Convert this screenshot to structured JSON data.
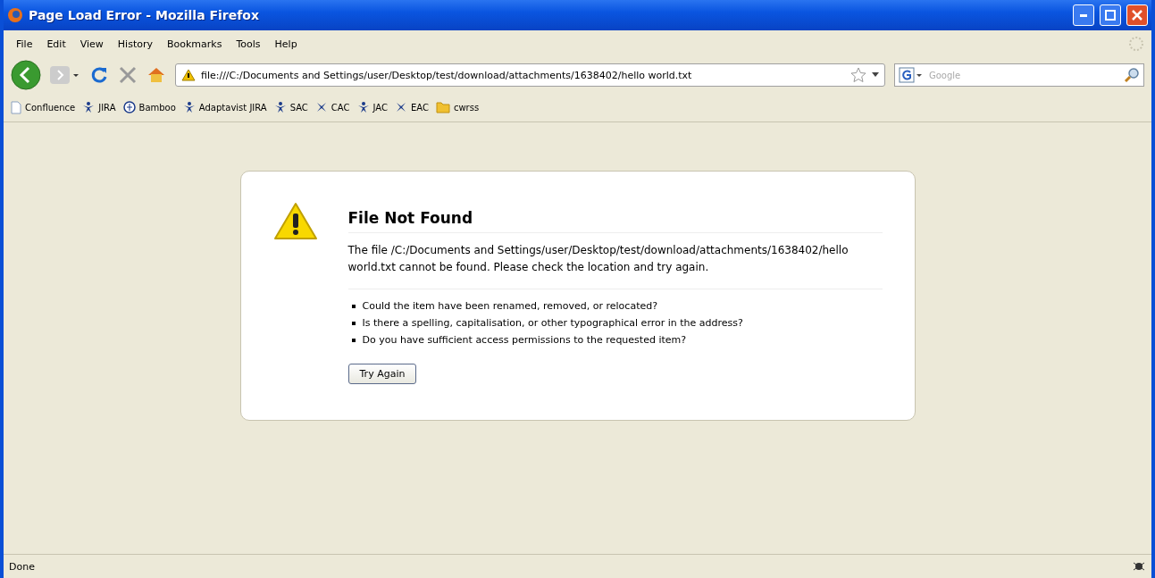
{
  "window": {
    "title": "Page Load Error - Mozilla Firefox"
  },
  "menu": [
    "File",
    "Edit",
    "View",
    "History",
    "Bookmarks",
    "Tools",
    "Help"
  ],
  "address_bar": {
    "value": "file:///C:/Documents and Settings/user/Desktop/test/download/attachments/1638402/hello world.txt"
  },
  "search": {
    "placeholder": "Google"
  },
  "bookmarks": [
    {
      "label": "Confluence",
      "kind": "page"
    },
    {
      "label": "JIRA",
      "kind": "person"
    },
    {
      "label": "Bamboo",
      "kind": "globe"
    },
    {
      "label": "Adaptavist JIRA",
      "kind": "person"
    },
    {
      "label": "SAC",
      "kind": "person"
    },
    {
      "label": "CAC",
      "kind": "cross"
    },
    {
      "label": "JAC",
      "kind": "person"
    },
    {
      "label": "EAC",
      "kind": "cross"
    },
    {
      "label": "cwrss",
      "kind": "folder"
    }
  ],
  "error": {
    "title": "File Not Found",
    "message": "The file /C:/Documents and Settings/user/Desktop/test/download/attachments/1638402/hello world.txt cannot be found. Please check the location and try again.",
    "hints": [
      "Could the item have been renamed, removed, or relocated?",
      "Is there a spelling, capitalisation, or other typographical error in the address?",
      "Do you have sufficient access permissions to the requested item?"
    ],
    "button": "Try Again"
  },
  "status_bar": {
    "text": "Done"
  }
}
